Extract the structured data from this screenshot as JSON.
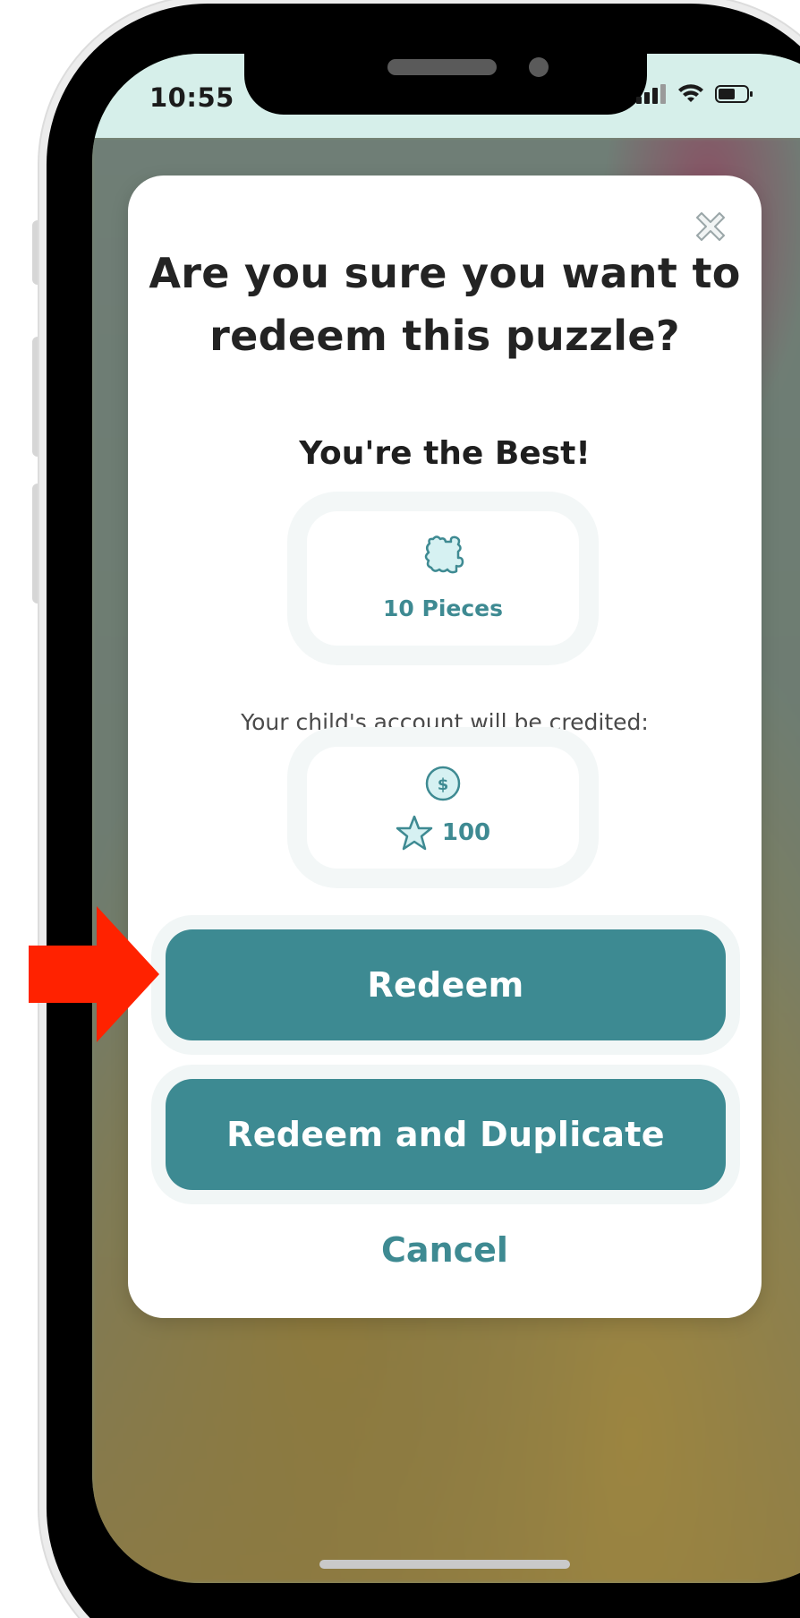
{
  "status_bar": {
    "time": "10:55"
  },
  "modal": {
    "title": "Are you sure you want to redeem this puzzle?",
    "puzzle_name": "You're the Best!",
    "pieces_label": "10 Pieces",
    "credit_text": "Your child's account will be credited:",
    "stars_value": "100",
    "redeem_label": "Redeem",
    "redeem_duplicate_label": "Redeem and Duplicate",
    "cancel_label": "Cancel"
  },
  "icons": {
    "close": "close-icon",
    "puzzle": "puzzle-piece-icon",
    "coin": "dollar-coin-icon",
    "star": "star-icon",
    "arrow": "red-arrow-annotation"
  },
  "colors": {
    "accent": "#3d8a92",
    "status_bar_bg": "#d6efea",
    "annotation_arrow": "#ff2200"
  }
}
